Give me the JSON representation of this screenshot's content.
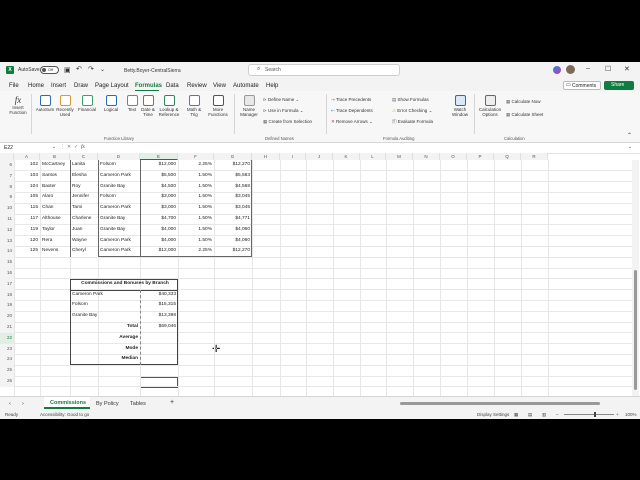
{
  "titlebar": {
    "autosave_label": "AutoSave",
    "autosave_state": "Off",
    "filename": "Betty.Boyer-CentralSierra",
    "search_placeholder": "Search"
  },
  "menu": {
    "tabs": [
      "File",
      "Home",
      "Insert",
      "Draw",
      "Page Layout",
      "Formulas",
      "Data",
      "Review",
      "View",
      "Automate",
      "Help"
    ],
    "active": "Formulas",
    "comments_label": "Comments",
    "share_label": "Share"
  },
  "ribbon": {
    "insert_function": "Insert Function",
    "library_buttons": [
      "AutoSum",
      "Recently Used",
      "Financial",
      "Logical",
      "Text",
      "Date & Time",
      "Lookup & Reference",
      "Math & Trig",
      "More Functions"
    ],
    "library_group": "Function Library",
    "name_manager": "Name Manager",
    "defined_names": [
      "Define Name",
      "Use in Formula",
      "Create from Selection"
    ],
    "defined_names_group": "Defined Names",
    "auditing_left": [
      "Trace Precedents",
      "Trace Dependents",
      "Remove Arrows"
    ],
    "auditing_right": [
      "Show Formulas",
      "Error Checking",
      "Evaluate Formula"
    ],
    "auditing_group": "Formula Auditing",
    "watch_window": "Watch Window",
    "calc_options": "Calculation Options",
    "calc_now": "Calculate Now",
    "calc_sheet": "Calculate Sheet",
    "calc_group": "Calculation"
  },
  "formula_bar": {
    "name_box": "E22",
    "fx": "fx",
    "content": ""
  },
  "columns": [
    "A",
    "B",
    "C",
    "D",
    "E",
    "F",
    "G",
    "H",
    "I",
    "J",
    "K",
    "L",
    "M",
    "N",
    "O",
    "P",
    "Q",
    "R"
  ],
  "rows": [
    {
      "num": "6",
      "a": "102",
      "b": "McCartney",
      "c": "Lanita",
      "d": "Folsom",
      "e": "$12,000",
      "f": "2.25%",
      "g": "$12,270"
    },
    {
      "num": "7",
      "a": "103",
      "b": "Santos",
      "c": "Elesha",
      "d": "Cameron Park",
      "e": "$5,500",
      "f": "1.50%",
      "g": "$5,583"
    },
    {
      "num": "8",
      "a": "104",
      "b": "Baxter",
      "c": "Roy",
      "d": "Granite Bay",
      "e": "$4,500",
      "f": "1.50%",
      "g": "$4,568"
    },
    {
      "num": "9",
      "a": "105",
      "b": "Alaro",
      "c": "Jennifer",
      "d": "Folsom",
      "e": "$3,000",
      "f": "1.50%",
      "g": "$3,045"
    },
    {
      "num": "10",
      "a": "115",
      "b": "Chan",
      "c": "Tami",
      "d": "Cameron Park",
      "e": "$3,000",
      "f": "1.50%",
      "g": "$3,045"
    },
    {
      "num": "11",
      "a": "117",
      "b": "Althouse",
      "c": "Charlene",
      "d": "Granite Bay",
      "e": "$4,700",
      "f": "1.50%",
      "g": "$4,771"
    },
    {
      "num": "12",
      "a": "119",
      "b": "Taylor",
      "c": "Juan",
      "d": "Granite Bay",
      "e": "$4,000",
      "f": "1.50%",
      "g": "$4,060"
    },
    {
      "num": "13",
      "a": "120",
      "b": "Rera",
      "c": "Wayne",
      "d": "Cameron Park",
      "e": "$4,000",
      "f": "1.50%",
      "g": "$4,060"
    },
    {
      "num": "14",
      "a": "125",
      "b": "Nevens",
      "c": "Cheryl",
      "d": "Cameron Park",
      "e": "$12,000",
      "f": "2.25%",
      "g": "$12,270"
    }
  ],
  "empty_rows": [
    "15",
    "16"
  ],
  "summary": {
    "title": "Commissions and Bonuses by Branch",
    "rows": [
      {
        "num": "17",
        "label": "",
        "value": ""
      },
      {
        "num": "18",
        "label": "Cameron Park",
        "value": "$40,333"
      },
      {
        "num": "19",
        "label": "Folsom",
        "value": "$15,315"
      },
      {
        "num": "20",
        "label": "Granite Bay",
        "value": "$13,398"
      },
      {
        "num": "21",
        "label": "Total",
        "value": "$69,046"
      },
      {
        "num": "22",
        "label": "Average",
        "value": ""
      },
      {
        "num": "23",
        "label": "Mode",
        "value": ""
      },
      {
        "num": "24",
        "label": "Median",
        "value": ""
      }
    ]
  },
  "more_rows": [
    "25",
    "26"
  ],
  "sheets": [
    "Commissions",
    "By Policy",
    "Tables"
  ],
  "active_sheet": "Commissions",
  "status": {
    "ready": "Ready",
    "accessibility": "Accessibility: Good to go",
    "display": "Display Settings",
    "zoom": "100%"
  },
  "colors": {
    "accent": "#107c41",
    "selection": "#107c41"
  }
}
